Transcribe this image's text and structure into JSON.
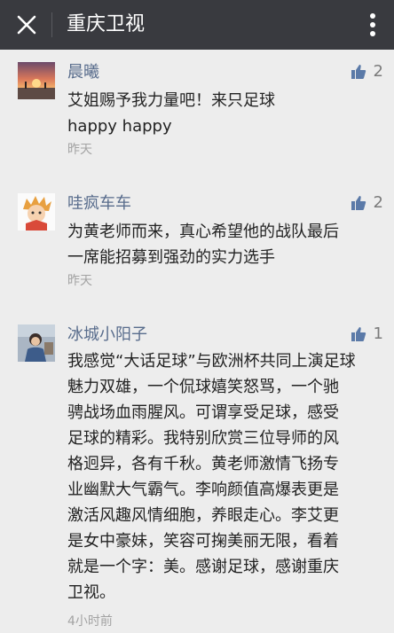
{
  "header": {
    "title": "重庆卫视"
  },
  "comments": [
    {
      "name": "晨曦",
      "likes": "2",
      "lines": [
        "艾姐赐予我力量吧！来只足球",
        "happy happy"
      ],
      "time": "昨天"
    },
    {
      "name": "哇疯车车",
      "likes": "2",
      "lines": [
        "为黄老师而来，真心希望他的战队最后",
        "一席能招募到强劲的实力选手"
      ],
      "time": "昨天"
    },
    {
      "name": "冰城小阳子",
      "likes": "1",
      "lines": [
        "我感觉“大话足球”与欧洲杯共同上演足球",
        "魅力双雄，一个侃球嬉笑怒骂，一个驰",
        "骋战场血雨腥风。可谓享受足球，感受",
        "足球的精彩。我特别欣赏三位导师的风",
        "格迥异，各有千秋。黄老师激情飞扬专",
        "业幽默大气霸气。李响颜值高爆表更是",
        "激活风趣风情细胞，养眼走心。李艾更",
        "是女中豪妹，笑容可掬美丽无限，看着",
        "就是一个字：美。感谢足球，感谢重庆",
        "卫视。"
      ],
      "time": "4小时前"
    }
  ],
  "colors": {
    "topbar": "#393a3f",
    "name": "#586c8c",
    "like_icon": "#5b7aa8",
    "time": "#a3a3a3"
  },
  "icons": {
    "close": "close-icon",
    "more": "more-vertical-icon",
    "like": "thumbs-up-icon"
  }
}
